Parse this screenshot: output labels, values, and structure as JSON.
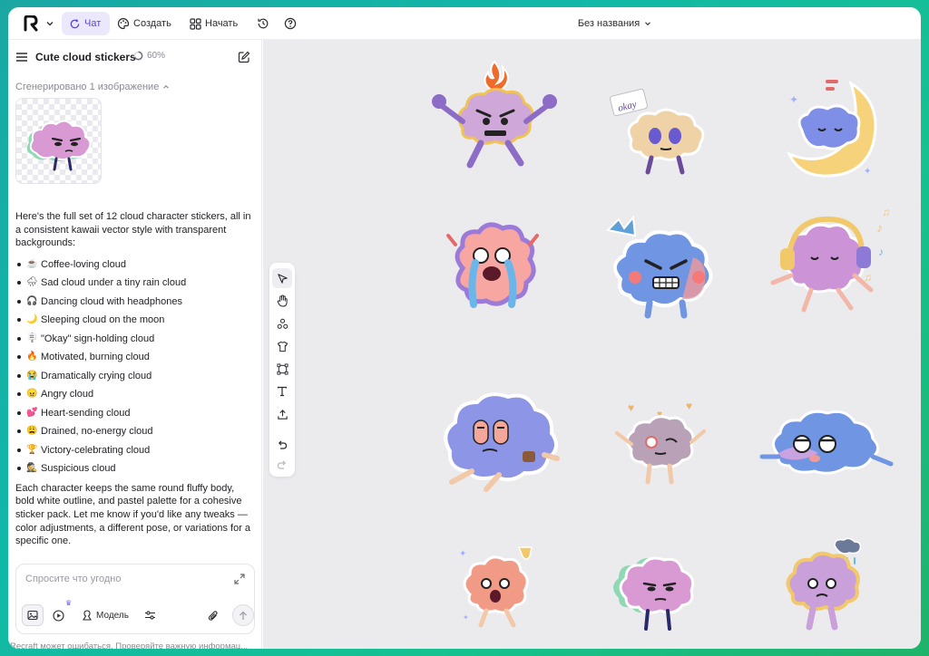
{
  "topbar": {
    "chat_label": "Чат",
    "create_label": "Создать",
    "start_label": "Начать",
    "doc_title": "Без названия"
  },
  "panel": {
    "title": "Cute cloud stickers",
    "progress": "60%",
    "generated_label": "Сгенерировано 1 изображение",
    "message_intro": "Here's the full set of 12 cloud character stickers, all in a consistent kawaii vector style with transparent backgrounds:",
    "list": [
      {
        "emoji": "☕",
        "text": "Coffee-loving cloud"
      },
      {
        "emoji": "🌧",
        "text": "Sad cloud under a tiny rain cloud"
      },
      {
        "emoji": "🎧",
        "text": "Dancing cloud with headphones"
      },
      {
        "emoji": "🌙",
        "text": "Sleeping cloud on the moon"
      },
      {
        "emoji": "🪧",
        "text": "\"Okay\" sign-holding cloud"
      },
      {
        "emoji": "🔥",
        "text": "Motivated, burning cloud"
      },
      {
        "emoji": "😭",
        "text": "Dramatically crying cloud"
      },
      {
        "emoji": "😠",
        "text": "Angry cloud"
      },
      {
        "emoji": "💕",
        "text": "Heart-sending cloud"
      },
      {
        "emoji": "😩",
        "text": "Drained, no-energy cloud"
      },
      {
        "emoji": "🏆",
        "text": "Victory-celebrating cloud"
      },
      {
        "emoji": "🕵",
        "text": "Suspicious cloud"
      }
    ],
    "message_outro": "Each character keeps the same round fluffy body, bold white outline, and pastel palette for a cohesive sticker pack. Let me know if you'd like any tweaks — color adjustments, a different pose, or variations for a specific one.",
    "composer_placeholder": "Спросите что угодно",
    "model_label": "Модель",
    "disclaimer": "Recraft может ошибаться. Проверяйте важную информац..."
  },
  "sticker_sign_text": "okay",
  "colors": {
    "accent": "#5b46d8",
    "accent_bg": "#ece8fb",
    "canvas_bg": "#ebebee",
    "frame_gradient_start": "#1aa7a3",
    "frame_gradient_end": "#1fb36a"
  }
}
